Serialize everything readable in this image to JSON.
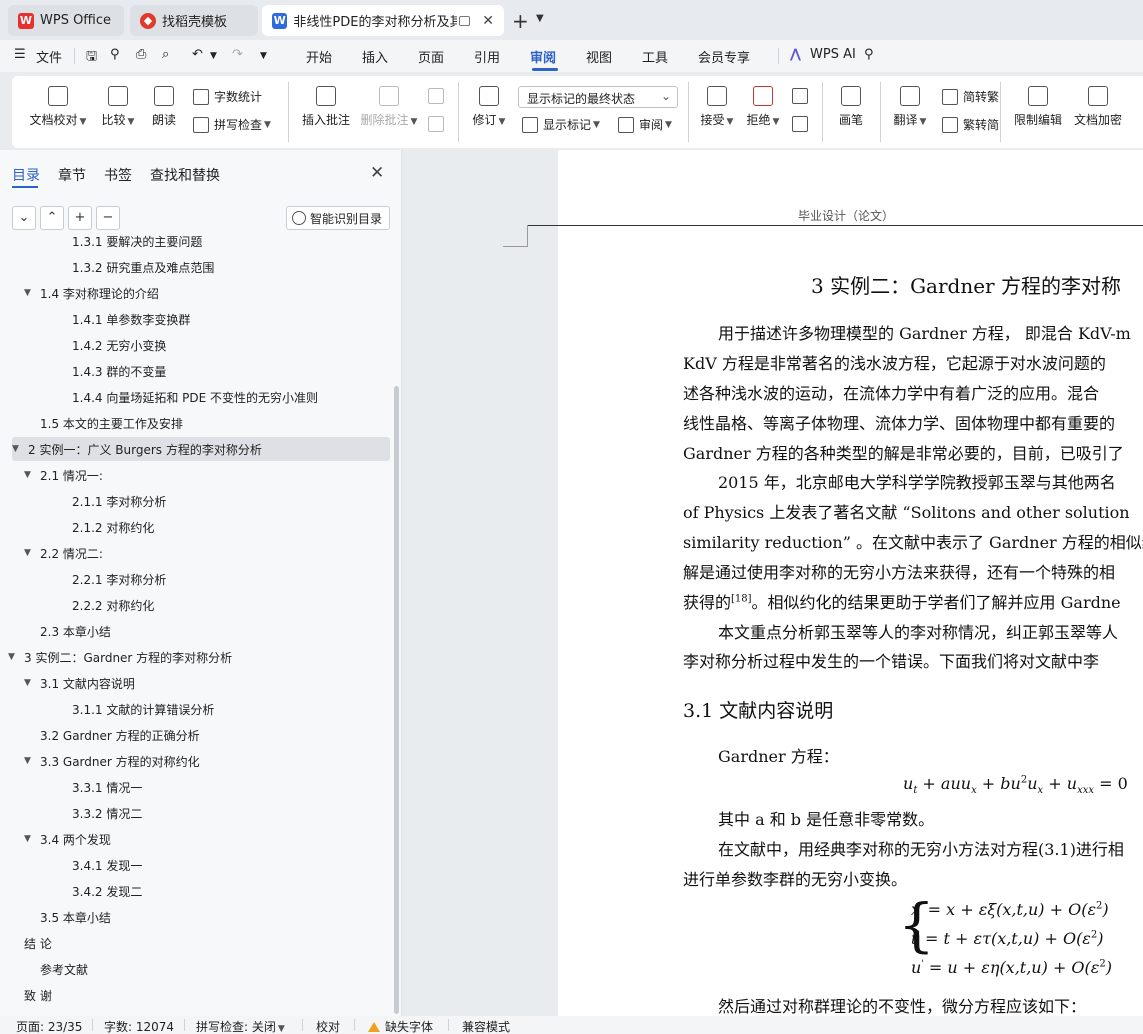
{
  "tabs": [
    {
      "label": "WPS Office",
      "icon": "wps-logo-icon"
    },
    {
      "label": "找稻壳模板",
      "icon": "daoke-logo-icon"
    },
    {
      "label": "非线性PDE的李对称分析及其",
      "icon": "wps-writer-icon"
    }
  ],
  "menu": {
    "file": "文件",
    "items": [
      "开始",
      "插入",
      "页面",
      "引用",
      "审阅",
      "视图",
      "工具",
      "会员专享"
    ],
    "active": "审阅",
    "wps_ai": "WPS AI"
  },
  "ribbon": {
    "doc_proof": "文档校对",
    "compare": "比较",
    "read_aloud": "朗读",
    "word_count": "字数统计",
    "spell_check": "拼写检查",
    "insert_comment": "插入批注",
    "delete_comment": "删除批注",
    "revise": "修订",
    "markup_state": "显示标记的最终状态",
    "show_markup": "显示标记",
    "review_pane": "审阅",
    "accept": "接受",
    "reject": "拒绝",
    "pen": "画笔",
    "translate": "翻译",
    "to_traditional": "简转繁",
    "to_simplified": "繁转简",
    "restrict_edit": "限制编辑",
    "encrypt": "文档加密"
  },
  "nav": {
    "tabs": [
      "目录",
      "章节",
      "书签",
      "查找和替换"
    ],
    "active_tab": "目录",
    "smart_toc": "智能识别目录",
    "toc": [
      {
        "text": "1.3.1  要解决的主要问题",
        "level": 3,
        "arrow": ""
      },
      {
        "text": "1.3.2  研究重点及难点范围",
        "level": 3,
        "arrow": ""
      },
      {
        "text": "1.4  李对称理论的介绍",
        "level": 2,
        "arrow": "▼"
      },
      {
        "text": "1.4.1  单参数李变换群",
        "level": 3,
        "arrow": ""
      },
      {
        "text": "1.4.2  无穷小变换",
        "level": 3,
        "arrow": ""
      },
      {
        "text": "1.4.3  群的不变量",
        "level": 3,
        "arrow": ""
      },
      {
        "text": "1.4.4  向量场延拓和 PDE 不变性的无穷小准则",
        "level": 3,
        "arrow": ""
      },
      {
        "text": "1.5  本文的主要工作及安排",
        "level": 2,
        "arrow": ""
      },
      {
        "text": "2  实例一：广义 Burgers 方程的李对称分析",
        "level": 1,
        "arrow": "▼",
        "selected": true
      },
      {
        "text": "2.1  情况一:",
        "level": 2,
        "arrow": "▼"
      },
      {
        "text": "2.1.1  李对称分析",
        "level": 3,
        "arrow": ""
      },
      {
        "text": "2.1.2  对称约化",
        "level": 3,
        "arrow": ""
      },
      {
        "text": "2.2  情况二:",
        "level": 2,
        "arrow": "▼"
      },
      {
        "text": "2.2.1  李对称分析",
        "level": 3,
        "arrow": ""
      },
      {
        "text": "2.2.2  对称约化",
        "level": 3,
        "arrow": ""
      },
      {
        "text": "2.3  本章小结",
        "level": 2,
        "arrow": ""
      },
      {
        "text": "3  实例二：Gardner 方程的李对称分析",
        "level": 1,
        "arrow": "▼"
      },
      {
        "text": "3.1  文献内容说明",
        "level": 2,
        "arrow": "▼"
      },
      {
        "text": "3.1.1  文献的计算错误分析",
        "level": 3,
        "arrow": ""
      },
      {
        "text": "3.2 Gardner 方程的正确分析",
        "level": 2,
        "arrow": ""
      },
      {
        "text": "3.3 Gardner 方程的对称约化",
        "level": 2,
        "arrow": "▼"
      },
      {
        "text": "3.3.1  情况一",
        "level": 3,
        "arrow": ""
      },
      {
        "text": "3.3.2  情况二",
        "level": 3,
        "arrow": ""
      },
      {
        "text": "3.4  两个发现",
        "level": 2,
        "arrow": "▼"
      },
      {
        "text": "3.4.1  发现一",
        "level": 3,
        "arrow": ""
      },
      {
        "text": "3.4.2  发现二",
        "level": 3,
        "arrow": ""
      },
      {
        "text": "3.5  本章小结",
        "level": 2,
        "arrow": ""
      },
      {
        "text": "结  论",
        "level": 1,
        "arrow": ""
      },
      {
        "text": "参考文献",
        "level": 2,
        "arrow": ""
      },
      {
        "text": "致  谢",
        "level": 1,
        "arrow": ""
      }
    ]
  },
  "doc": {
    "header": "毕业设计（论文）",
    "chapter_title": "3  实例二：Gardner 方程的李对称",
    "lines": [
      "用于描述许多物理模型的 Gardner 方程，  即混合 KdV-m",
      "KdV 方程是非常著名的浅水波方程，它起源于对水波问题的",
      "述各种浅水波的运动，在流体力学中有着广泛的应用。混合",
      "线性晶格、等离子体物理、流体力学、固体物理中都有重要的",
      "Gardner 方程的各种类型的解是非常必要的，目前，已吸引了",
      "2015 年，北京邮电大学科学学院教授郭玉翠与其他两名",
      "of Physics 上发表了著名文献 “Solitons and other solution",
      "similarity reduction” 。在文献中表示了 Gardner 方程的相似约",
      "解是通过使用李对称的无穷小方法来获得，还有一个特殊的相",
      "获得的",
      "。相似约化的结果更助于学者们了解并应用 Gardne",
      "本文重点分析郭玉翠等人的李对称情况，纠正郭玉翠等人",
      "李对称分析过程中发生的一个错误。下面我们将对文献中李"
    ],
    "citation": "[18]",
    "section_title": "3.1  文献内容说明",
    "gardner_label": "Gardner 方程：",
    "equation_main": "u",
    "eq_text": "其中 a 和 b 是任意非零常数。",
    "para2_1": "在文献中，用经典李对称的无穷小方法对方程(3.1)进行相",
    "para2_2": "进行单参数李群的无穷小变换。",
    "last_line": "然后通过对称群理论的不变性，微分方程应该如下："
  },
  "status": {
    "page": "页面: 23/35",
    "words": "字数: 12074",
    "spell": "拼写检查: 关闭",
    "proof": "校对",
    "missing_font": "缺失字体",
    "compat": "兼容模式"
  }
}
